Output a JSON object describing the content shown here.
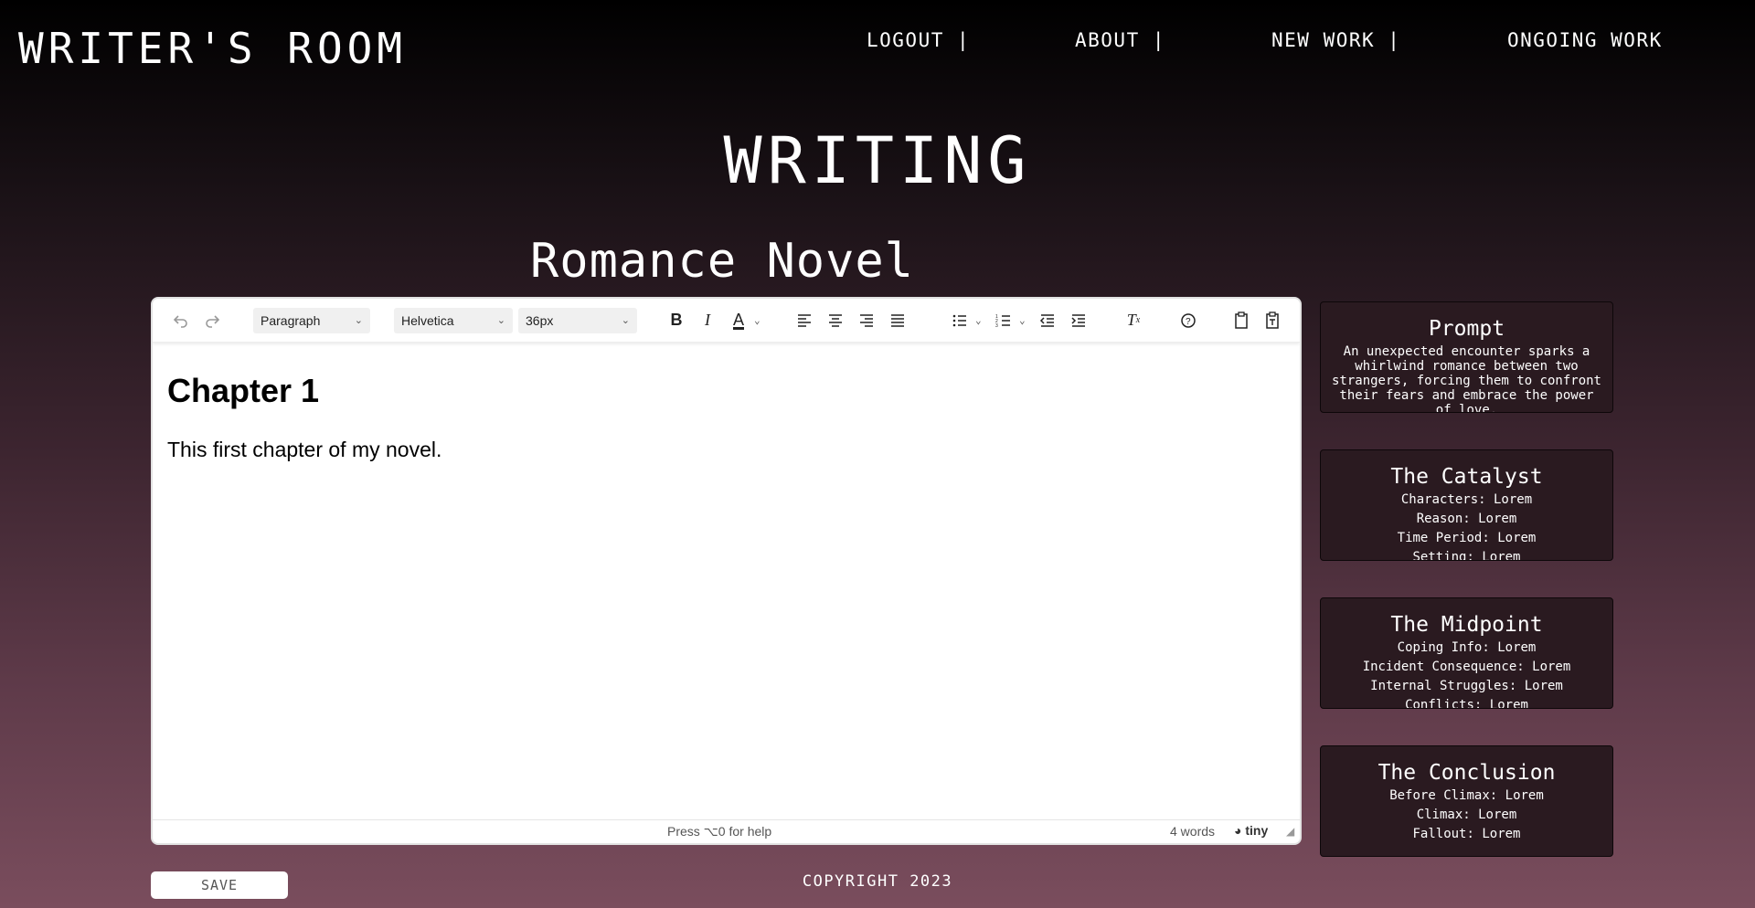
{
  "app": {
    "logo": "WRITER'S ROOM"
  },
  "nav": {
    "logout": "LOGOUT  |",
    "about": "ABOUT  |",
    "new_work": "NEW WORK  |",
    "ongoing_work": "ONGOING WORK"
  },
  "page": {
    "title": "WRITING",
    "work_title": "Romance Novel"
  },
  "editor": {
    "toolbar": {
      "block_format": "Paragraph",
      "font_family": "Helvetica",
      "font_size": "36px"
    },
    "content": {
      "heading": "Chapter 1",
      "paragraph": "This first chapter of my novel."
    },
    "status": {
      "help": "Press ⌥0 for help",
      "word_count": "4 words",
      "brand": "tiny"
    }
  },
  "cards": {
    "prompt": {
      "title": "Prompt",
      "body": "An unexpected encounter sparks a whirlwind romance between two strangers, forcing them to confront their fears and embrace the power of love."
    },
    "catalyst": {
      "title": "The Catalyst",
      "lines": [
        "Characters: Lorem",
        "Reason: Lorem",
        "Time Period: Lorem",
        "Setting: Lorem"
      ]
    },
    "midpoint": {
      "title": "The Midpoint",
      "lines": [
        "Coping Info: Lorem",
        "Incident Consequence: Lorem",
        "Internal Struggles: Lorem",
        "Conflicts: Lorem"
      ]
    },
    "conclusion": {
      "title": "The Conclusion",
      "lines": [
        "Before Climax: Lorem",
        "Climax: Lorem",
        "Fallout: Lorem"
      ]
    }
  },
  "actions": {
    "save": "SAVE"
  },
  "footer": {
    "copyright": "COPYRIGHT 2023"
  },
  "colors": {
    "card_bg": "#2a1a20",
    "accent_text": "#ffffff"
  }
}
